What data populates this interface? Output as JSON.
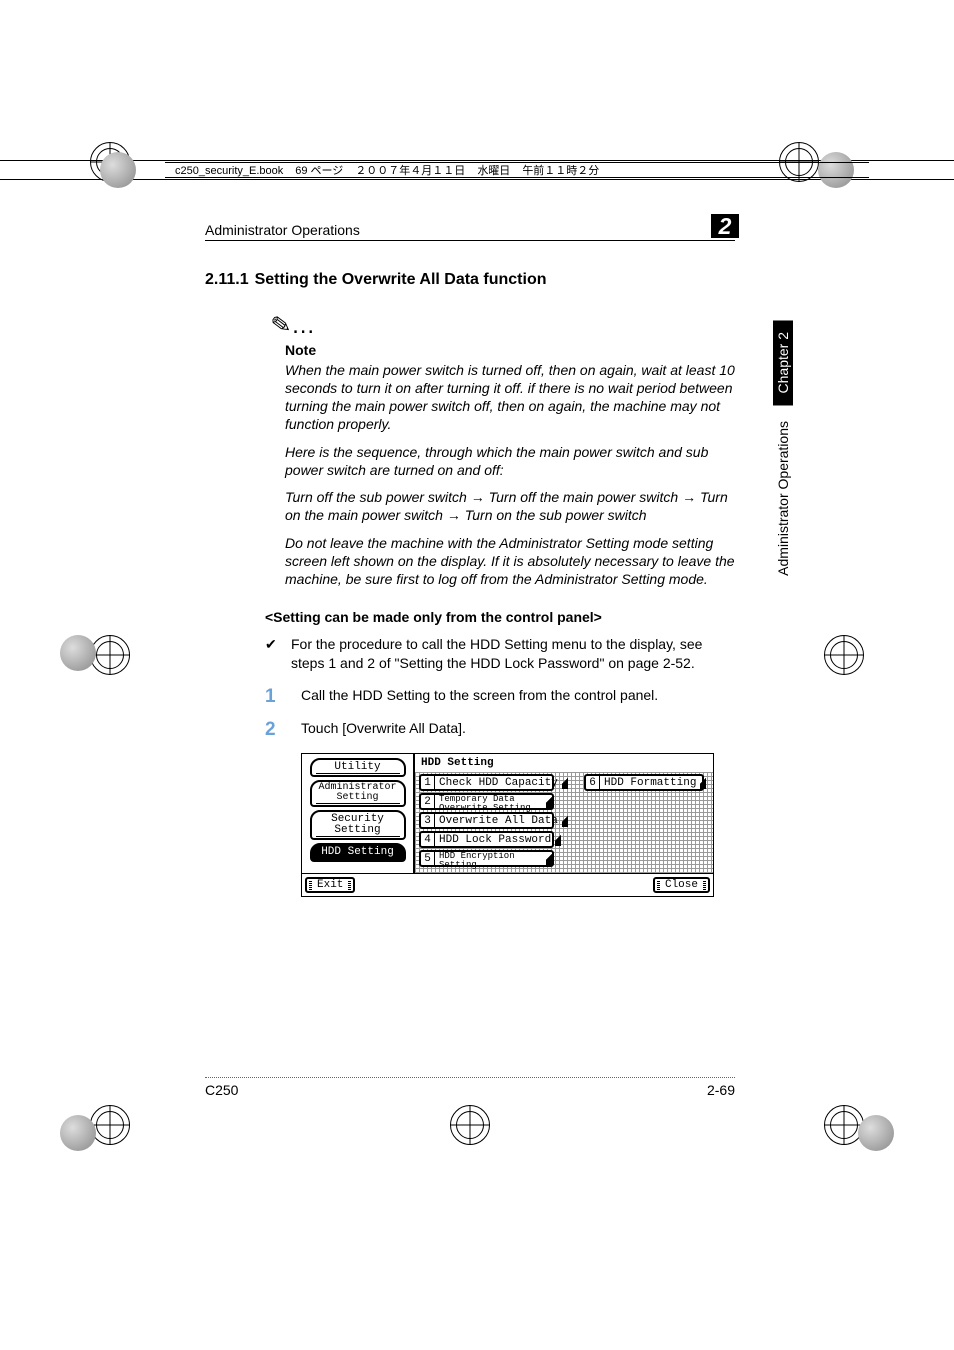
{
  "crop_header": {
    "file": "c250_security_E.book",
    "page": "69 ページ",
    "date": "２００７年４月１１日",
    "day": "水曜日",
    "time": "午前１１時２分"
  },
  "running_head": {
    "section": "Administrator Operations",
    "chapter_number": "2"
  },
  "heading": {
    "number": "2.11.1",
    "title": "Setting the Overwrite All Data function"
  },
  "note": {
    "label": "Note",
    "p1": "When the main power switch is turned off, then on again, wait at least 10 seconds to turn it on after turning it off. if there is no wait period between turning the main power switch off, then on again, the machine may not function properly.",
    "p2": "Here is the sequence, through which the main power switch and sub power switch are turned on and off:",
    "p3a": "Turn off the sub power switch ",
    "p3b": " Turn off the main power switch ",
    "p3c": " Turn on the main power switch ",
    "p3d": " Turn on the sub power switch",
    "p4": "Do not leave the machine with the Administrator Setting mode setting screen left shown on the display. If it is absolutely necessary to leave the machine, be sure first to log off from the Administrator Setting mode."
  },
  "arrow": "→",
  "subhead": "<Setting can be made only from the control panel>",
  "bullet": "For the procedure to call the HDD Setting menu to the display, see steps 1 and 2 of \"Setting the HDD Lock Password\" on page 2-52.",
  "step1": "Call the HDD Setting to the screen from the control panel.",
  "step2": "Touch [Overwrite All Data].",
  "screenshot": {
    "left_tabs": {
      "utility": "Utility",
      "admin": "Administrator\nSetting",
      "security": "Security Setting",
      "hdd": "HDD Setting"
    },
    "right_title": "HDD Setting",
    "items": {
      "i1": "Check HDD Capacity",
      "i2": "Temporary Data\nOverwrite Setting",
      "i3": "Overwrite All Data",
      "i4": "HDD Lock Password",
      "i5": "HDD Encryption\nSetting",
      "i6": "HDD Formatting"
    },
    "exit": "Exit",
    "close": "Close"
  },
  "sidebar": {
    "chapter": "Chapter 2",
    "section": "Administrator Operations"
  },
  "footer": {
    "model": "C250",
    "page": "2-69"
  }
}
